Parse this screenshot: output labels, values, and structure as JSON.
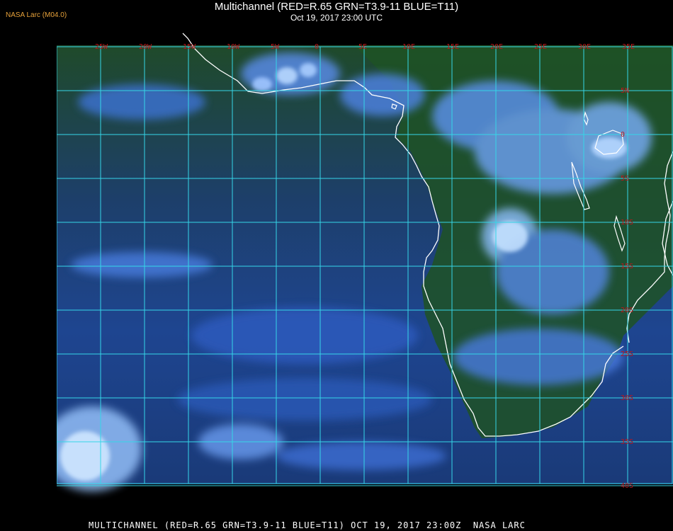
{
  "header": {
    "source_tag": "NASA Larc (M04.0)",
    "title": "Multichannel (RED=R.65 GRN=T3.9-11 BLUE=T11)",
    "subtitle": "Oct 19, 2017 23:00 UTC"
  },
  "footer": {
    "caption": "MULTICHANNEL (RED=R.65 GRN=T3.9-11 BLUE=T11) OCT 19, 2017 23:00Z  NASA LARC"
  },
  "map": {
    "longitude_labels": [
      "25W",
      "20W",
      "15W",
      "10W",
      "5W",
      "0",
      "5E",
      "10E",
      "15E",
      "20E",
      "25E",
      "30E",
      "35E"
    ],
    "latitude_labels": [
      "5N",
      "0",
      "5S",
      "10S",
      "15S",
      "20S",
      "25S",
      "30S",
      "35S",
      "40S"
    ],
    "colors": {
      "grid": "#35d6e8",
      "label": "#c0151a",
      "coast": "#ffffff",
      "land": "#1f4a1e",
      "ocean": "#1d3f7e",
      "cloud": "#6fa8ff"
    }
  }
}
